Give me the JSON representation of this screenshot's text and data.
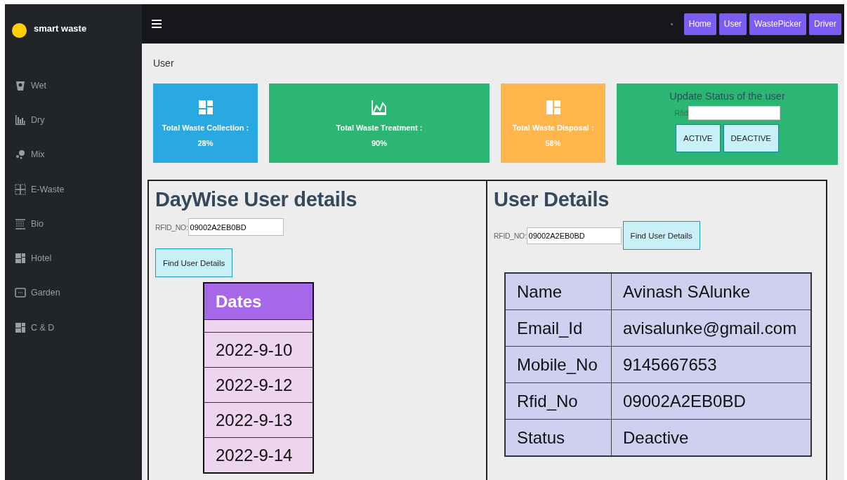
{
  "brand": {
    "name": "smart waste"
  },
  "sidebar": {
    "items": [
      {
        "label": "Wet"
      },
      {
        "label": "Dry"
      },
      {
        "label": "Mix"
      },
      {
        "label": "E-Waste"
      },
      {
        "label": "Bio"
      },
      {
        "label": "Hotel"
      },
      {
        "label": "Garden"
      },
      {
        "label": "C & D"
      }
    ]
  },
  "nav": {
    "buttons": [
      "Home",
      "User",
      "WastePicker",
      "Driver"
    ]
  },
  "breadcrumb": "User",
  "stats": [
    {
      "label": "Total Waste Collection :",
      "value": "28%",
      "color": "#29a9e1"
    },
    {
      "label": "Total Waste Treatment :",
      "value": "90%",
      "color": "#2bb673"
    },
    {
      "label": "Total Waste Disposal :",
      "value": "58%",
      "color": "#ffb64d"
    }
  ],
  "status_panel": {
    "title": "Update Status of the user",
    "field_label": "Rfid",
    "buttons": [
      "ACTIVE",
      "DEACTIVE"
    ]
  },
  "daywise": {
    "title": "DayWise User details",
    "field_label": "RFID_NO:",
    "value": "09002A2EB0BD",
    "button": "Find User Details",
    "table_header": "Dates",
    "rows": [
      "2022-9-10",
      "2022-9-12",
      "2022-9-13",
      "2022-9-14"
    ]
  },
  "details": {
    "title": "User Details",
    "field_label": "RFID_NO:",
    "value": "09002A2EB0BD",
    "button": "Find User Details",
    "rows": [
      {
        "field": "Name",
        "value": "Avinash SAlunke"
      },
      {
        "field": "Email_Id",
        "value": "avisalunke@gmail.com"
      },
      {
        "field": "Mobile_No",
        "value": "9145667653"
      },
      {
        "field": "Rfid_No",
        "value": "09002A2EB0BD"
      },
      {
        "field": "Status",
        "value": "Deactive"
      }
    ]
  }
}
